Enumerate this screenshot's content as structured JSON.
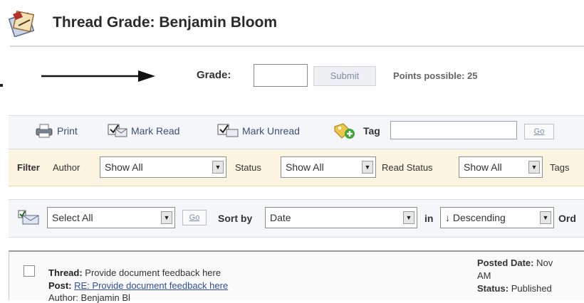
{
  "header": {
    "title": "Thread Grade: Benjamin Bloom",
    "icon": "grade-book-icon"
  },
  "grade": {
    "label": "Grade:",
    "value": "",
    "submit_label": "Submit",
    "points_possible": "Points possible: 25"
  },
  "actions": {
    "print": "Print",
    "mark_read": "Mark Read",
    "mark_unread": "Mark Unread",
    "tag_label": "Tag",
    "tag_value": "",
    "go": "Go"
  },
  "filter": {
    "filter_label": "Filter",
    "author_label": "Author",
    "author_value": "Show All",
    "status_label": "Status",
    "status_value": "Show All",
    "read_status_label": "Read Status",
    "read_status_value": "Show All",
    "tags_label": "Tags"
  },
  "sort": {
    "select_all": "Select All",
    "go": "Go",
    "sort_by_label": "Sort by",
    "sort_by_value": "Date",
    "in_label": "in",
    "order_value": "↓ Descending",
    "order_label_partial": "Ord"
  },
  "thread": {
    "thread_label": "Thread:",
    "thread_value": "Provide document feedback here",
    "post_label": "Post:",
    "post_value": "RE: Provide document feedback here",
    "author_partial": "Author: Benjamin Bl",
    "posted_date_label": "Posted Date:",
    "posted_date_value": "Nov",
    "posted_time_partial": "AM",
    "status_label": "Status:",
    "status_value": "Published"
  },
  "colors": {
    "filter_bg": "#fbf4e1",
    "bar_bg": "#f4f6f9",
    "link": "#2f4fa0"
  }
}
